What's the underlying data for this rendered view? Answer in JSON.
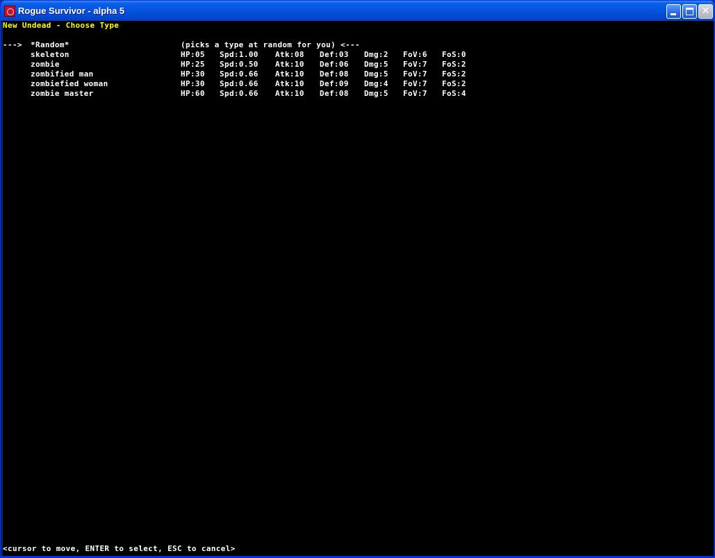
{
  "window": {
    "title": "Rogue Survivor - alpha 5",
    "icon": "app-icon",
    "controls": {
      "minimize": "minimize-icon",
      "maximize": "maximize-icon",
      "close": "close-icon"
    }
  },
  "screen": {
    "heading": "New Undead - Choose Type",
    "cursor": "--->",
    "options": [
      {
        "name": "*Random*",
        "description": "(picks a type at random for you) <---"
      },
      {
        "name": "skeleton",
        "hp": "HP:05",
        "spd": "Spd:1.00",
        "atk": "Atk:08",
        "def": "Def:03",
        "dmg": "Dmg:2",
        "fov": "FoV:6",
        "fos": "FoS:0"
      },
      {
        "name": "zombie",
        "hp": "HP:25",
        "spd": "Spd:0.50",
        "atk": "Atk:10",
        "def": "Def:06",
        "dmg": "Dmg:5",
        "fov": "FoV:7",
        "fos": "FoS:2"
      },
      {
        "name": "zombified man",
        "hp": "HP:30",
        "spd": "Spd:0.66",
        "atk": "Atk:10",
        "def": "Def:08",
        "dmg": "Dmg:5",
        "fov": "FoV:7",
        "fos": "FoS:2"
      },
      {
        "name": "zombiefied woman",
        "hp": "HP:30",
        "spd": "Spd:0.66",
        "atk": "Atk:10",
        "def": "Def:09",
        "dmg": "Dmg:4",
        "fov": "FoV:7",
        "fos": "FoS:2"
      },
      {
        "name": "zombie master",
        "hp": "HP:60",
        "spd": "Spd:0.66",
        "atk": "Atk:10",
        "def": "Def:08",
        "dmg": "Dmg:5",
        "fov": "FoV:7",
        "fos": "FoS:4"
      }
    ],
    "footer": "<cursor to move, ENTER to select, ESC to cancel>"
  },
  "colors": {
    "heading": "#ffff00",
    "text": "#ffffff",
    "background": "#000000",
    "titlebar": "#0553e0"
  }
}
